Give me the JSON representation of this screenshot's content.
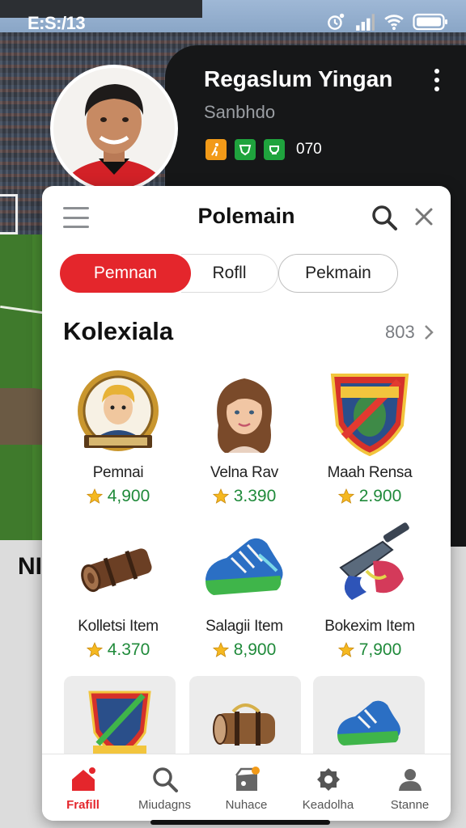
{
  "status_bar": {
    "time": "E:S:/13"
  },
  "profile": {
    "name": "Regaslum Yingan",
    "subtitle": "Sanbhdo",
    "badge_count": "070",
    "badge_colors": [
      "#f29a18",
      "#1fa33d",
      "#1fa33d"
    ]
  },
  "behind_card": {
    "title_fragment": "NI"
  },
  "modal": {
    "title": "Polemain",
    "tabs": [
      {
        "label": "Pemnan",
        "active": true
      },
      {
        "label": "Rofll",
        "active": false
      },
      {
        "label": "Pekmain",
        "active": false
      }
    ],
    "section": {
      "title": "Kolexiala",
      "count": "803"
    },
    "items": [
      {
        "name": "Pemnai",
        "price": "4,900",
        "icon": "player-emblem-icon"
      },
      {
        "name": "Velna Rav",
        "price": "3.390",
        "icon": "female-avatar-icon"
      },
      {
        "name": "Maah Rensa",
        "price": "2.900",
        "icon": "shield-crest-icon"
      },
      {
        "name": "Kolletsi Item",
        "price": "4.370",
        "icon": "log-bundle-icon"
      },
      {
        "name": "Salagii Item",
        "price": "8,900",
        "icon": "sneaker-icon"
      },
      {
        "name": "Bokexim Item",
        "price": "7,900",
        "icon": "mech-weapon-icon"
      }
    ],
    "tiles": [
      "shield-crest-icon",
      "treasure-bundle-icon",
      "sneaker-icon"
    ]
  },
  "bottom_nav": [
    {
      "label": "Frafill",
      "icon": "home-icon",
      "active": true
    },
    {
      "label": "Miudagns",
      "icon": "search-icon",
      "active": false
    },
    {
      "label": "Nuhace",
      "icon": "shop-icon",
      "active": false
    },
    {
      "label": "Keadolha",
      "icon": "settings-icon",
      "active": false
    },
    {
      "label": "Stanne",
      "icon": "profile-icon",
      "active": false
    }
  ],
  "colors": {
    "accent_red": "#e4262c",
    "price_green": "#1f8a3a",
    "dark_panel": "#161718"
  }
}
